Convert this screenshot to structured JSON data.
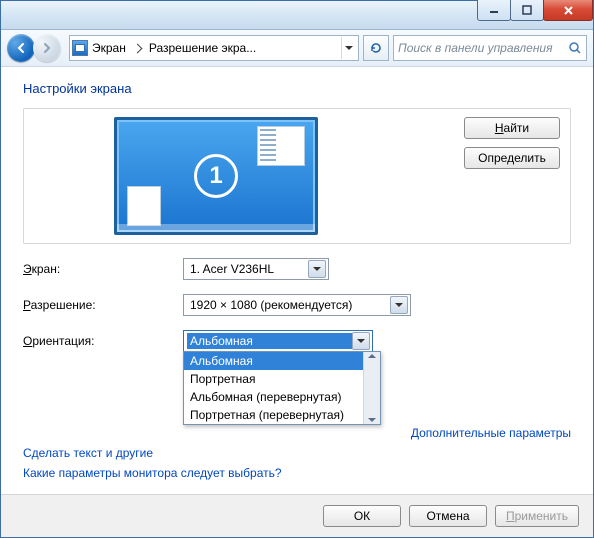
{
  "titlebar": {},
  "nav": {
    "crumb1": "Экран",
    "crumb2": "Разрешение экра...",
    "search_placeholder": "Поиск в панели управления"
  },
  "page_title": "Настройки экрана",
  "preview": {
    "monitor_number": "1"
  },
  "side_buttons": {
    "find_prefix": "Н",
    "find_rest": "айти",
    "identify": "Определить"
  },
  "labels": {
    "display_prefix": "Э",
    "display_rest": "кран:",
    "resolution_prefix": "Р",
    "resolution_rest": "азрешение:",
    "orientation_prefix": "О",
    "orientation_rest": "риентация:"
  },
  "display_dd": {
    "value": "1. Acer V236HL"
  },
  "resolution_dd": {
    "value": "1920 × 1080 (рекомендуется)"
  },
  "orientation_dd": {
    "value": "Альбомная",
    "options": [
      "Альбомная",
      "Портретная",
      "Альбомная (перевернутая)",
      "Портретная (перевернутая)"
    ]
  },
  "links": {
    "advanced": "Дополнительные параметры",
    "text_size": "Сделать текст и другие",
    "which_settings": "Какие параметры монитора следует выбрать?"
  },
  "footer": {
    "ok": "ОК",
    "cancel": "Отмена",
    "apply_prefix": "П",
    "apply_rest": "рименить"
  }
}
